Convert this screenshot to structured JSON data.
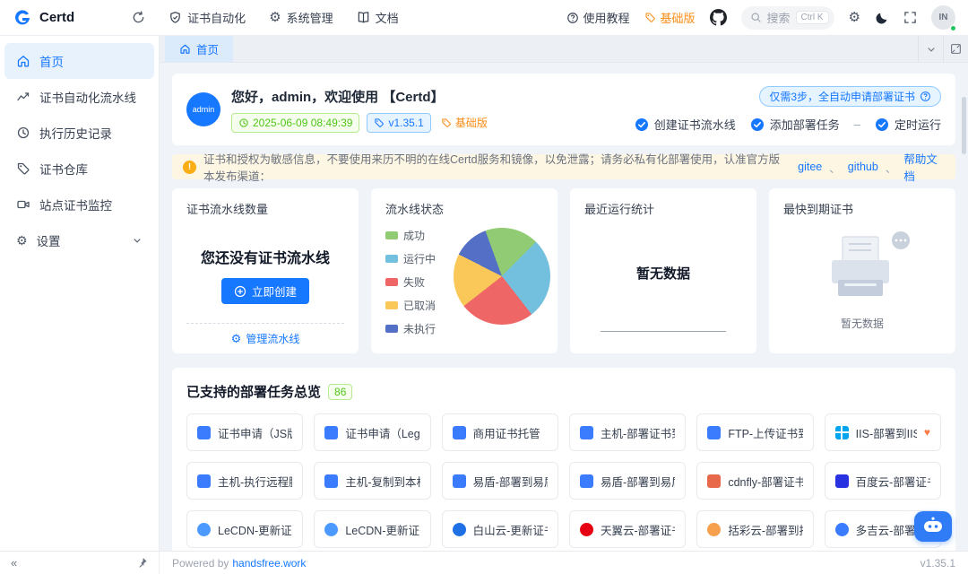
{
  "topbar": {
    "logo_text": "Certd",
    "nav": [
      {
        "label": "证书自动化"
      },
      {
        "label": "系统管理"
      },
      {
        "label": "文档"
      }
    ],
    "tutorial_label": "使用教程",
    "edition_badge": "基础版",
    "search": {
      "placeholder": "搜索",
      "shortcut": "Ctrl K"
    },
    "avatar_text": "IN"
  },
  "sidebar": {
    "items": [
      {
        "label": "首页"
      },
      {
        "label": "证书自动化流水线"
      },
      {
        "label": "执行历史记录"
      },
      {
        "label": "证书仓库"
      },
      {
        "label": "站点证书监控"
      },
      {
        "label": "设置"
      }
    ]
  },
  "tabbar": {
    "active_tab": "首页"
  },
  "welcome": {
    "avatar_text": "admin",
    "greeting": "您好，admin，欢迎使用 【Certd】",
    "datetime_badge": "2025-06-09 08:49:39",
    "version_badge": "v1.35.1",
    "edition_badge": "基础版",
    "steps_pill": "仅需3步，全自动申请部署证书",
    "steps": [
      {
        "label": "创建证书流水线"
      },
      {
        "label": "添加部署任务"
      },
      {
        "label": "定时运行"
      }
    ],
    "steps_separator": "–"
  },
  "notice": {
    "text": "证书和授权为敏感信息，不要使用来历不明的在线Certd服务和镜像，以免泄露；请务必私有化部署使用，认准官方版本发布渠道：",
    "links": [
      {
        "label": "gitee"
      },
      {
        "label": "github"
      },
      {
        "label": "帮助文档"
      }
    ],
    "link_separator": "、"
  },
  "stats": {
    "pipeline_card": {
      "title": "证书流水线数量",
      "empty_text": "您还没有证书流水线",
      "create_button": "立即创建",
      "manage_link": "管理流水线"
    },
    "status_card": {
      "title": "流水线状态",
      "legend": [
        {
          "label": "成功",
          "color": "#91cc75",
          "value": 18
        },
        {
          "label": "运行中",
          "color": "#73c0de",
          "value": 27
        },
        {
          "label": "失败",
          "color": "#ee6666",
          "value": 25
        },
        {
          "label": "已取消",
          "color": "#fac858",
          "value": 18
        },
        {
          "label": "未执行",
          "color": "#5470c6",
          "value": 12
        }
      ]
    },
    "recent_card": {
      "title": "最近运行统计",
      "empty_text": "暂无数据"
    },
    "expire_card": {
      "title": "最快到期证书",
      "empty_text": "暂无数据"
    }
  },
  "tasks": {
    "title": "已支持的部署任务总览",
    "count": "86",
    "items": [
      {
        "label": "证书申请（JS版）",
        "icon": "certificate-icon",
        "color": "#3b7cff",
        "shape": "square"
      },
      {
        "label": "证书申请（Lego",
        "icon": "certificate-icon",
        "color": "#3b7cff",
        "shape": "square"
      },
      {
        "label": "商用证书托管",
        "icon": "briefcase-icon",
        "color": "#3b7cff",
        "shape": "square"
      },
      {
        "label": "主机-部署证书到",
        "icon": "host-icon",
        "color": "#3b7cff",
        "shape": "square"
      },
      {
        "label": "FTP-上传证书到",
        "icon": "ftp-icon",
        "color": "#3b7cff",
        "shape": "square"
      },
      {
        "label": "IIS-部署到IIS",
        "icon": "windows-icon",
        "color": "#00a4ef",
        "shape": "windows",
        "suffix": "♥"
      },
      {
        "label": "主机-执行远程脚",
        "icon": "terminal-icon",
        "color": "#3b7cff",
        "shape": "square"
      },
      {
        "label": "主机-复制到本机",
        "icon": "copy-icon",
        "color": "#3b7cff",
        "shape": "square"
      },
      {
        "label": "易盾-部署到易盾",
        "icon": "shield-icon",
        "color": "#3b7cff",
        "shape": "square"
      },
      {
        "label": "易盾-部署到易盾",
        "icon": "shield-icon",
        "color": "#3b7cff",
        "shape": "square"
      },
      {
        "label": "cdnfly-部署证书",
        "icon": "cdn-icon",
        "color": "#e8684a",
        "shape": "square"
      },
      {
        "label": "百度云-部署证书",
        "icon": "baidu-cloud-icon",
        "color": "#2932e1",
        "shape": "square"
      },
      {
        "label": "LeCDN-更新证书",
        "icon": "lecdn-icon",
        "color": "#4c9aff",
        "shape": "circle"
      },
      {
        "label": "LeCDN-更新证书",
        "icon": "lecdn-icon",
        "color": "#4c9aff",
        "shape": "circle"
      },
      {
        "label": "白山云-更新证书",
        "icon": "baishan-icon",
        "color": "#1f6fe5",
        "shape": "circle"
      },
      {
        "label": "天翼云-部署证书",
        "icon": "ctyun-icon",
        "color": "#e60012",
        "shape": "circle"
      },
      {
        "label": "括彩云-部署到括",
        "icon": "kuocai-icon",
        "color": "#f6a04d",
        "shape": "circle"
      },
      {
        "label": "多吉云-部署到多",
        "icon": "dogecloud-icon",
        "color": "#3b7cff",
        "shape": "circle"
      }
    ]
  },
  "footer": {
    "powered_by": "Powered by",
    "brand_link": "handsfree.work",
    "version": "v1.35.1"
  }
}
